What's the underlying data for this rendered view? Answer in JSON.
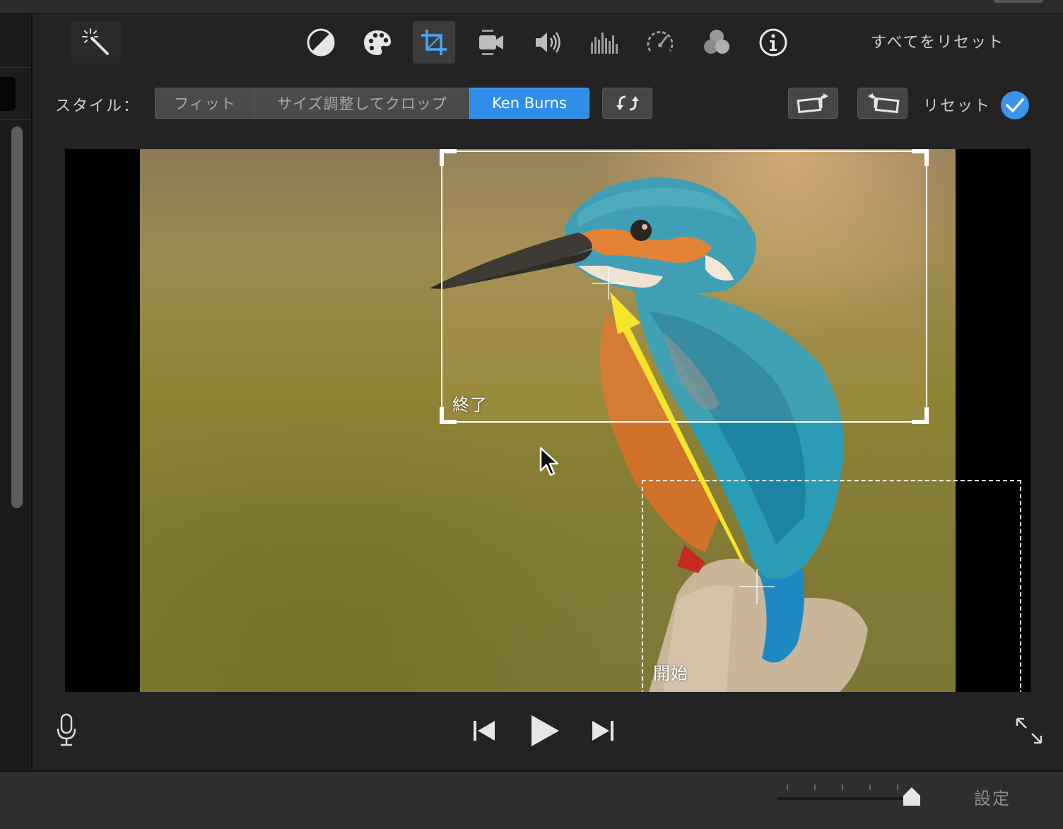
{
  "toolbar": {
    "reset_all_label": "すべてをリセット",
    "tools": [
      {
        "name": "color-balance-icon"
      },
      {
        "name": "color-palette-icon"
      },
      {
        "name": "crop-icon",
        "active": true
      },
      {
        "name": "stabilization-camera-icon"
      },
      {
        "name": "volume-icon"
      },
      {
        "name": "equalizer-icon"
      },
      {
        "name": "speed-gauge-icon"
      },
      {
        "name": "video-filter-icon"
      },
      {
        "name": "info-icon"
      }
    ],
    "magic_wand": "magic-wand-icon",
    "active_color": "#3b94ea"
  },
  "style_row": {
    "label": "スタイル：",
    "segments": [
      {
        "label": "フィット",
        "active": false
      },
      {
        "label": "サイズ調整してクロップ",
        "active": false
      },
      {
        "label": "Ken Burns",
        "active": true
      }
    ],
    "reset_label": "リセット"
  },
  "viewer": {
    "end_label": "終了",
    "start_label": "開始",
    "arrow_color": "#f5e52a"
  },
  "bottom_bar": {
    "settings_label": "設定",
    "zoom_slider_value": 0.99
  }
}
